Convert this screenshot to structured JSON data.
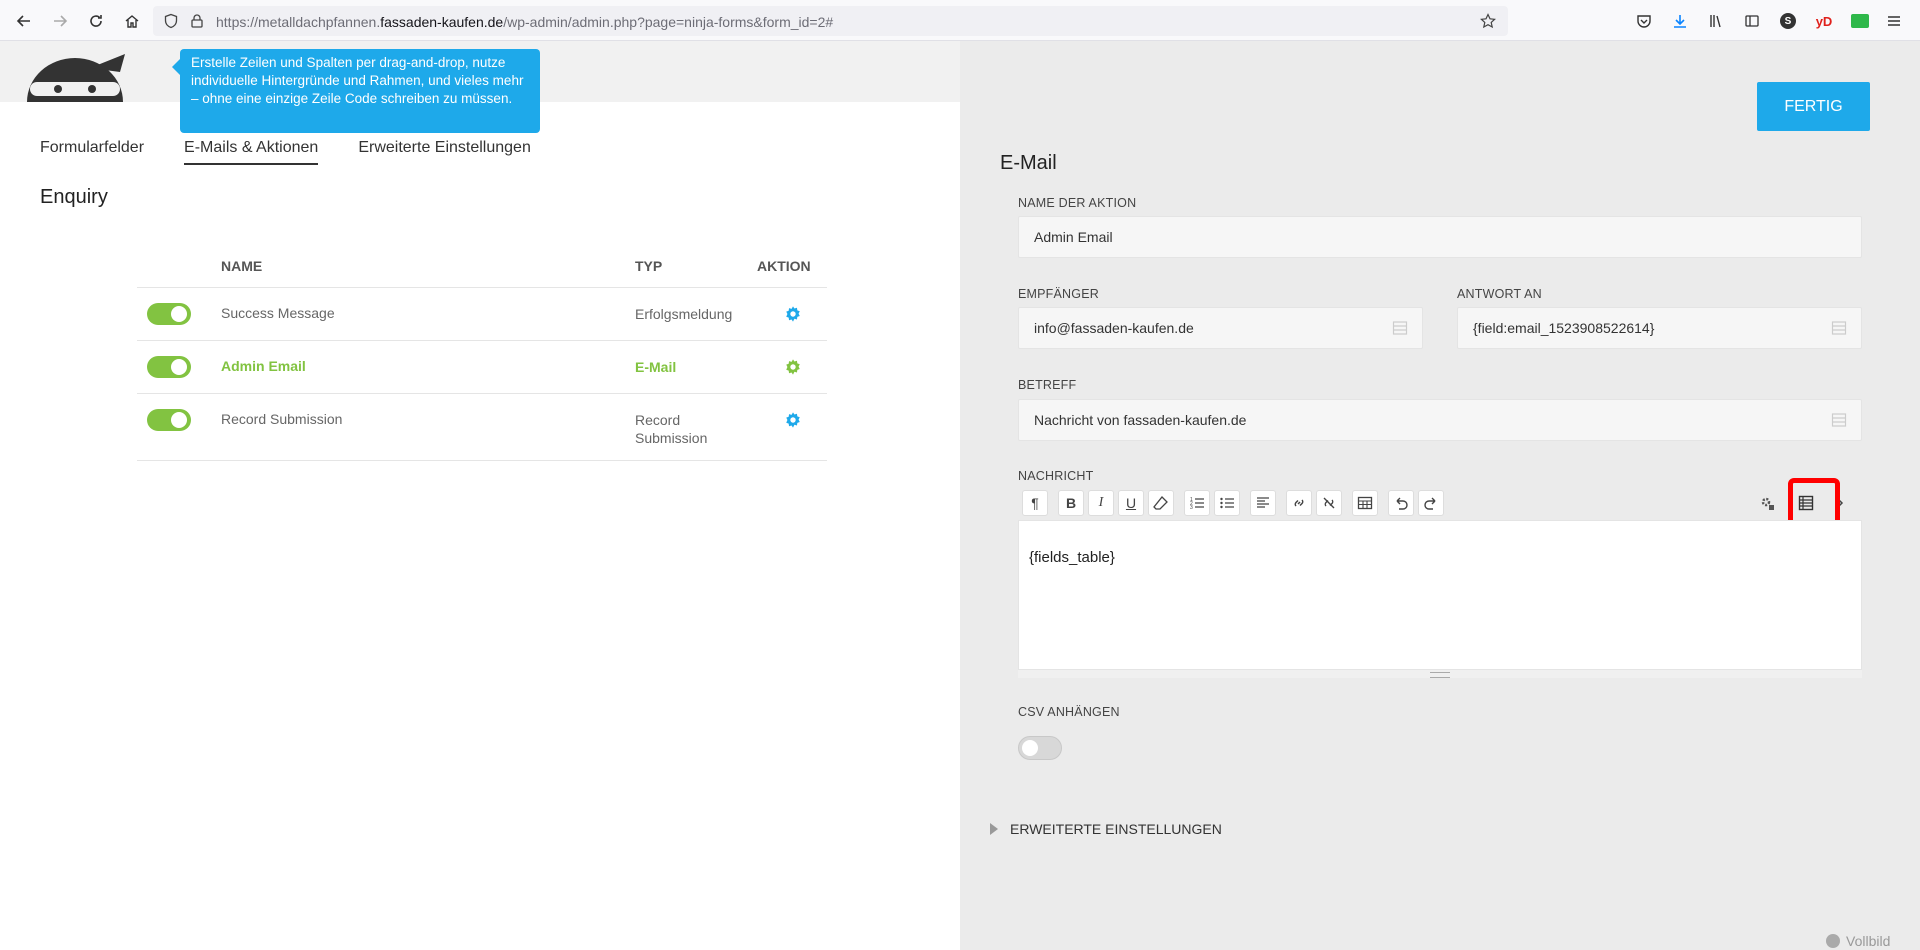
{
  "browser": {
    "url_prefix": "https://metalldachpfannen.",
    "url_domain": "fassaden-kaufen.de",
    "url_path": "/wp-admin/admin.php?page=ninja-forms&form_id=2#",
    "icons": [
      "back-icon",
      "forward-icon",
      "reload-icon",
      "home-icon",
      "shield-icon",
      "lock-icon",
      "star-icon",
      "pocket-icon",
      "download-icon",
      "library-icon",
      "sidebar-icon",
      "account-icon",
      "yd-icon",
      "extension-icon",
      "menu-icon"
    ],
    "account_letter": "S",
    "yd_label": "yD"
  },
  "tooltip": {
    "text": "Erstelle Zeilen und Spalten per drag-and-drop, nutze individuelle Hintergründe und Rahmen, und vieles mehr – ohne eine einzige Zeile Code schreiben zu müssen."
  },
  "tabs": [
    {
      "label": "Formularfelder",
      "active": false
    },
    {
      "label": "E-Mails & Aktionen",
      "active": true
    },
    {
      "label": "Erweiterte Einstellungen",
      "active": false
    }
  ],
  "form_title": "Enquiry",
  "actions_table": {
    "headers": {
      "name": "NAME",
      "type": "TYP",
      "action": "AKTION"
    },
    "rows": [
      {
        "name": "Success Message",
        "type": "Erfolgsmeldung",
        "enabled": true,
        "active": false
      },
      {
        "name": "Admin Email",
        "type": "E-Mail",
        "enabled": true,
        "active": true
      },
      {
        "name": "Record Submission",
        "type": "Record Submission",
        "enabled": true,
        "active": false
      }
    ]
  },
  "right_panel": {
    "done_label": "FERTIG",
    "title": "E-Mail",
    "action_name_label": "NAME DER AKTION",
    "action_name_value": "Admin Email",
    "recipient_label": "EMPFÄNGER",
    "recipient_value": "info@fassaden-kaufen.de",
    "reply_to_label": "ANTWORT AN",
    "reply_to_value": "{field:email_1523908522614}",
    "subject_label": "BETREFF",
    "subject_value": "Nachricht von fassaden-kaufen.de",
    "message_label": "NACHRICHT",
    "message_value": "{fields_table}",
    "csv_label": "CSV ANHÄNGEN",
    "csv_enabled": false,
    "advanced_label": "ERWEITERTE EINSTELLUNGEN",
    "fullscreen_label": "Vollbild"
  },
  "colors": {
    "accent_blue": "#1ea9ea",
    "active_green": "#82c341",
    "highlight_red": "#ff0000",
    "panel_gray": "#ebebeb"
  }
}
